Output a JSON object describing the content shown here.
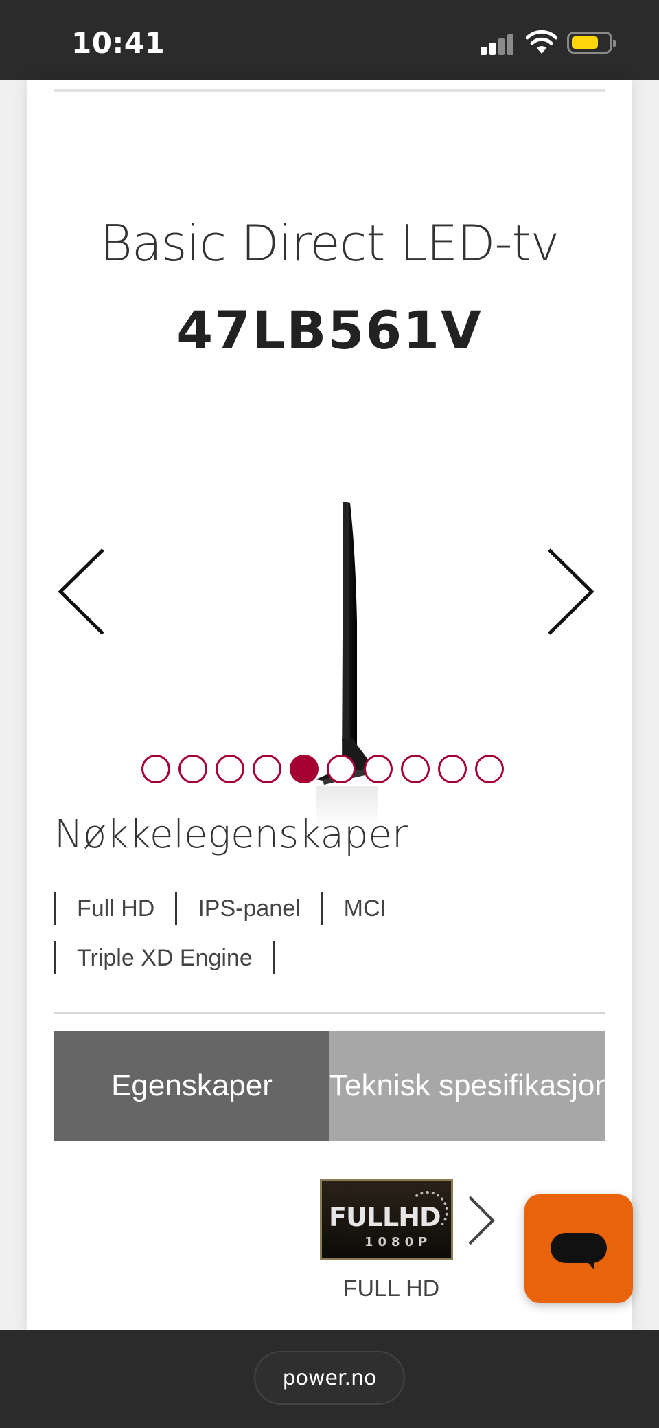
{
  "status_bar": {
    "time": "10:41"
  },
  "product": {
    "category": "Basic Direct LED-tv",
    "model": "47LB561V"
  },
  "gallery": {
    "total_slides": 10,
    "active_slide": 5
  },
  "key_features": {
    "title": "Nøkkelegenskaper",
    "items": [
      "Full HD",
      "IPS-panel",
      "MCI",
      "Triple XD Engine"
    ]
  },
  "tabs": [
    {
      "label": "Egenskaper",
      "active": true
    },
    {
      "label": "Teknisk spesifikasjoner",
      "active": false
    }
  ],
  "feature_carousel": {
    "badge_line1": "FULLHD",
    "badge_line2": "1080P",
    "label": "FULL HD"
  },
  "browser": {
    "url": "power.no"
  },
  "colors": {
    "accent": "#a50034",
    "chat_button": "#e8630a",
    "tab_active": "#666666",
    "tab_inactive": "#a7a7a7"
  },
  "icons": {
    "prev": "chevron-left-icon",
    "next": "chevron-right-icon",
    "chat": "chat-bubble-icon"
  }
}
